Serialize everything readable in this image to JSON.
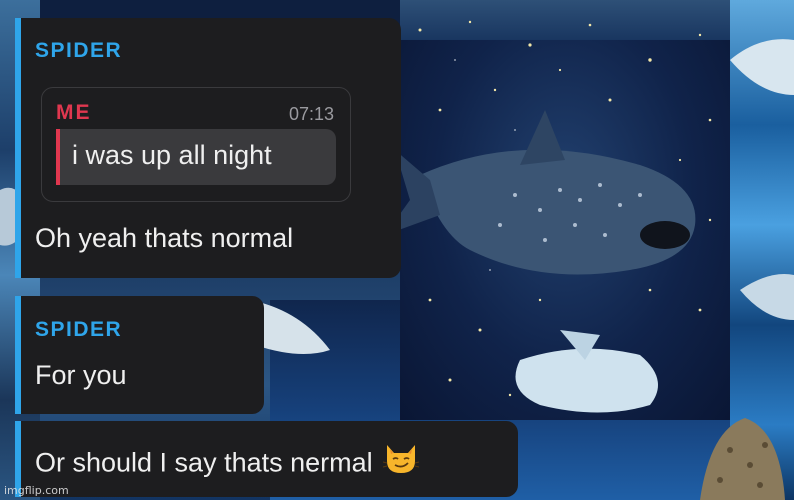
{
  "messages": [
    {
      "sender": "SPIDER",
      "quote": {
        "sender": "ME",
        "time": "07:13",
        "text": "i was up all night"
      },
      "text": "Oh yeah thats normal"
    },
    {
      "sender": "SPIDER",
      "text": "For you"
    },
    {
      "text": "Or should I say thats nermal",
      "emoji": "smirking-cat-emoji"
    }
  ],
  "watermark": "imgflip.com",
  "colors": {
    "accent_sender": "#2fa5ea",
    "quote_sender": "#e0374f",
    "bubble_bg": "#1d1d1f",
    "quote_bg": "#3a3a3d"
  }
}
